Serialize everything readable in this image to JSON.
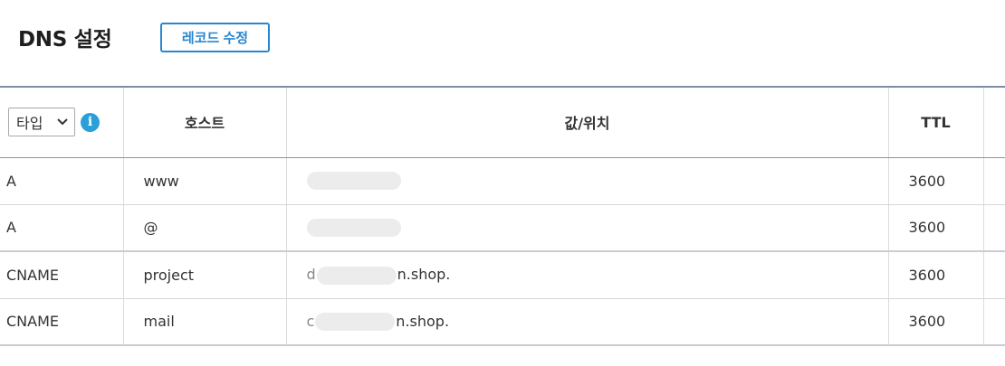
{
  "header": {
    "title": "DNS 설정",
    "edit_button": "레코드 수정"
  },
  "table": {
    "type_filter": {
      "selected": "타입",
      "icon": "chevron-down-icon",
      "info_icon": "info-icon",
      "info_glyph": "i"
    },
    "columns": [
      "호스트",
      "값/위치",
      "TTL"
    ],
    "rows": [
      {
        "type": "A",
        "host": "www",
        "value_prefix": "",
        "value_suffix": "",
        "ttl": "3600"
      },
      {
        "type": "A",
        "host": "@",
        "value_prefix": "",
        "value_suffix": "",
        "ttl": "3600"
      },
      {
        "type": "CNAME",
        "host": "project",
        "value_prefix": "d",
        "value_suffix": "n.shop.",
        "ttl": "3600"
      },
      {
        "type": "CNAME",
        "host": "mail",
        "value_prefix": "c",
        "value_suffix": "n.shop.",
        "ttl": "3600"
      }
    ]
  },
  "colors": {
    "accent": "#2a86cf",
    "info": "#2a9fd8",
    "header_border": "#7a8fa6"
  }
}
